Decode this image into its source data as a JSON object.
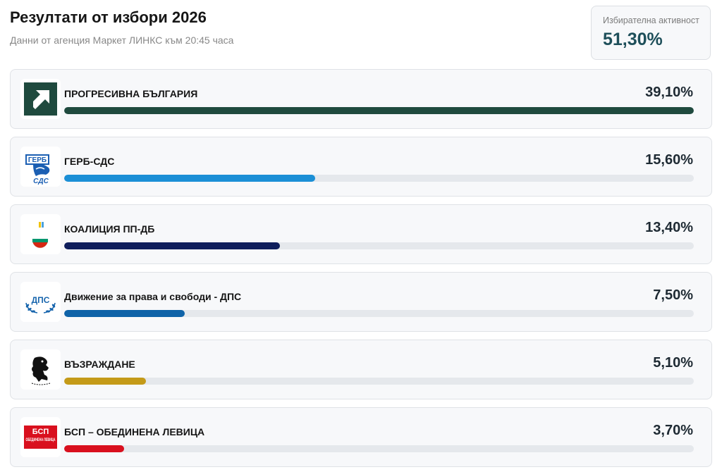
{
  "header": {
    "title": "Резултати от избори 2026",
    "subtitle": "Данни от агенция Маркет ЛИНКС към 20:45 часа"
  },
  "turnout": {
    "label": "Избирателна активност",
    "value": "51,30%",
    "color": "#1e4f5a"
  },
  "parties": [
    {
      "name": "ПРОГРЕСИВНА БЪЛГАРИЯ",
      "percent_label": "39,10%",
      "share": 39.1,
      "color": "#1f4a3e",
      "logo_icon": "progressive-bulgaria-arrow-icon"
    },
    {
      "name": "ГЕРБ-СДС",
      "percent_label": "15,60%",
      "share": 15.6,
      "color": "#1b8fd6",
      "logo_icon": "gerb-lion-icon",
      "logo_text_top": "ГЕРБ",
      "logo_text_bottom": "СДС"
    },
    {
      "name": "КОАЛИЦИЯ ПП-ДБ",
      "percent_label": "13,40%",
      "share": 13.4,
      "color": "#0f1e5c",
      "logo_icon": "pp-db-flag-icon"
    },
    {
      "name": "Движение за права и свободи - ДПС",
      "percent_label": "7,50%",
      "share": 7.5,
      "color": "#0f63a8",
      "logo_icon": "dps-laurel-icon",
      "logo_text_top": "ДПС"
    },
    {
      "name": "ВЪЗРАЖДАНЕ",
      "percent_label": "5,10%",
      "share": 5.1,
      "color": "#c49a18",
      "logo_icon": "vazrazhdane-lion-icon"
    },
    {
      "name": "БСП – ОБЕДИНЕНА ЛЕВИЦА",
      "percent_label": "3,70%",
      "share": 3.7,
      "color": "#d9101e",
      "logo_icon": "bsp-logo-icon",
      "logo_text_top": "БСП",
      "logo_text_bottom": "ОБЕДИНЕНА ЛЕВИЦА"
    }
  ]
}
